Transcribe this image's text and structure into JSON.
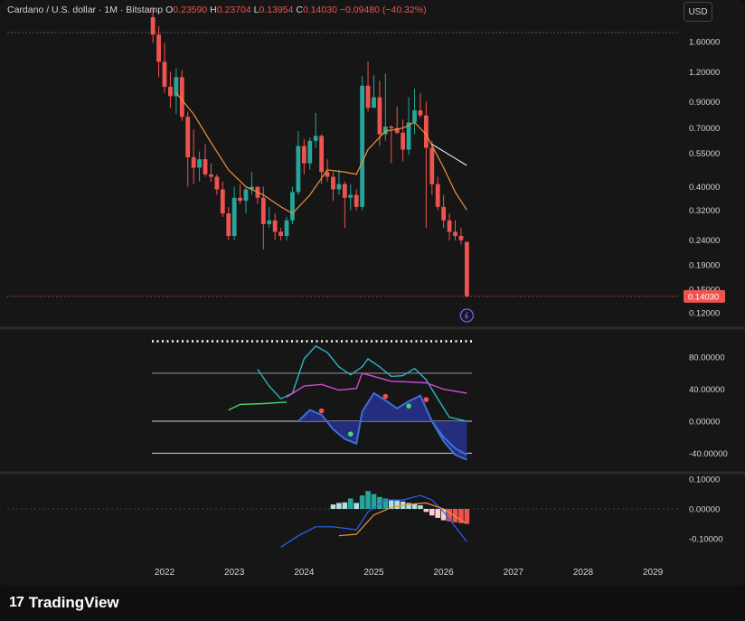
{
  "header": {
    "symbol": "Cardano / U.S. dollar · 1M · Bitstamp",
    "open_label": "O",
    "open": "0.23590",
    "high_label": "H",
    "high": "0.23704",
    "low_label": "L",
    "low": "0.13954",
    "close_label": "C",
    "close": "0.14030",
    "change": "−0.09480 (−40.32%)"
  },
  "currency": "USD",
  "brand": {
    "logo": "17",
    "name": "TradingView"
  },
  "colors": {
    "up": "#26a69a",
    "down": "#ef5350",
    "ma": "#f0923a",
    "ma_tail": "#ffffff",
    "accent": "#7b5cff"
  },
  "chart_data": [
    {
      "type": "candlestick",
      "y_scale": "log",
      "ylim": [
        0.11,
        1.9
      ],
      "yticks": [
        "1.60000",
        "1.20000",
        "0.90000",
        "0.70000",
        "0.55000",
        "0.40000",
        "0.32000",
        "0.24000",
        "0.19000",
        "0.15000",
        "0.12000"
      ],
      "last_price_label": "0.14030",
      "xticks": [
        "2022",
        "2023",
        "2024",
        "2025",
        "2026",
        "2027",
        "2028",
        "2029"
      ],
      "candles": [
        {
          "date": "2021-11",
          "o": 2.02,
          "h": 2.21,
          "l": 1.58,
          "c": 1.71
        },
        {
          "date": "2021-12",
          "o": 1.71,
          "h": 1.85,
          "l": 1.14,
          "c": 1.32
        },
        {
          "date": "2022-01",
          "o": 1.32,
          "h": 1.58,
          "l": 0.98,
          "c": 1.04
        },
        {
          "date": "2022-02",
          "o": 1.04,
          "h": 1.2,
          "l": 0.85,
          "c": 0.95
        },
        {
          "date": "2022-03",
          "o": 0.95,
          "h": 1.24,
          "l": 0.8,
          "c": 1.14
        },
        {
          "date": "2022-04",
          "o": 1.14,
          "h": 1.22,
          "l": 0.75,
          "c": 0.78
        },
        {
          "date": "2022-05",
          "o": 0.78,
          "h": 0.82,
          "l": 0.4,
          "c": 0.53
        },
        {
          "date": "2022-06",
          "o": 0.53,
          "h": 0.69,
          "l": 0.41,
          "c": 0.48
        },
        {
          "date": "2022-07",
          "o": 0.48,
          "h": 0.56,
          "l": 0.42,
          "c": 0.52
        },
        {
          "date": "2022-08",
          "o": 0.52,
          "h": 0.6,
          "l": 0.44,
          "c": 0.45
        },
        {
          "date": "2022-09",
          "o": 0.45,
          "h": 0.5,
          "l": 0.42,
          "c": 0.44
        },
        {
          "date": "2022-10",
          "o": 0.44,
          "h": 0.45,
          "l": 0.37,
          "c": 0.39
        },
        {
          "date": "2022-11",
          "o": 0.39,
          "h": 0.42,
          "l": 0.3,
          "c": 0.31
        },
        {
          "date": "2022-12",
          "o": 0.31,
          "h": 0.33,
          "l": 0.24,
          "c": 0.25
        },
        {
          "date": "2023-01",
          "o": 0.25,
          "h": 0.4,
          "l": 0.24,
          "c": 0.36
        },
        {
          "date": "2023-02",
          "o": 0.36,
          "h": 0.41,
          "l": 0.34,
          "c": 0.35
        },
        {
          "date": "2023-03",
          "o": 0.35,
          "h": 0.4,
          "l": 0.31,
          "c": 0.39
        },
        {
          "date": "2023-04",
          "o": 0.39,
          "h": 0.46,
          "l": 0.37,
          "c": 0.4
        },
        {
          "date": "2023-05",
          "o": 0.4,
          "h": 0.4,
          "l": 0.34,
          "c": 0.36
        },
        {
          "date": "2023-06",
          "o": 0.36,
          "h": 0.4,
          "l": 0.22,
          "c": 0.28
        },
        {
          "date": "2023-07",
          "o": 0.28,
          "h": 0.33,
          "l": 0.27,
          "c": 0.29
        },
        {
          "date": "2023-08",
          "o": 0.29,
          "h": 0.31,
          "l": 0.24,
          "c": 0.26
        },
        {
          "date": "2023-09",
          "o": 0.26,
          "h": 0.27,
          "l": 0.24,
          "c": 0.25
        },
        {
          "date": "2023-10",
          "o": 0.25,
          "h": 0.3,
          "l": 0.24,
          "c": 0.29
        },
        {
          "date": "2023-11",
          "o": 0.29,
          "h": 0.4,
          "l": 0.28,
          "c": 0.38
        },
        {
          "date": "2023-12",
          "o": 0.38,
          "h": 0.68,
          "l": 0.37,
          "c": 0.59
        },
        {
          "date": "2024-01",
          "o": 0.59,
          "h": 0.63,
          "l": 0.45,
          "c": 0.5
        },
        {
          "date": "2024-02",
          "o": 0.5,
          "h": 0.64,
          "l": 0.47,
          "c": 0.62
        },
        {
          "date": "2024-03",
          "o": 0.62,
          "h": 0.81,
          "l": 0.58,
          "c": 0.65
        },
        {
          "date": "2024-04",
          "o": 0.65,
          "h": 0.66,
          "l": 0.41,
          "c": 0.46
        },
        {
          "date": "2024-05",
          "o": 0.46,
          "h": 0.52,
          "l": 0.42,
          "c": 0.44
        },
        {
          "date": "2024-06",
          "o": 0.44,
          "h": 0.46,
          "l": 0.35,
          "c": 0.39
        },
        {
          "date": "2024-07",
          "o": 0.39,
          "h": 0.47,
          "l": 0.37,
          "c": 0.41
        },
        {
          "date": "2024-08",
          "o": 0.41,
          "h": 0.42,
          "l": 0.27,
          "c": 0.36
        },
        {
          "date": "2024-09",
          "o": 0.36,
          "h": 0.41,
          "l": 0.32,
          "c": 0.37
        },
        {
          "date": "2024-10",
          "o": 0.37,
          "h": 0.39,
          "l": 0.32,
          "c": 0.33
        },
        {
          "date": "2024-11",
          "o": 0.33,
          "h": 1.15,
          "l": 0.32,
          "c": 1.05
        },
        {
          "date": "2024-12",
          "o": 1.05,
          "h": 1.32,
          "l": 0.82,
          "c": 0.85
        },
        {
          "date": "2025-01",
          "o": 0.85,
          "h": 1.16,
          "l": 0.85,
          "c": 0.94
        },
        {
          "date": "2025-02",
          "o": 0.94,
          "h": 1.1,
          "l": 0.59,
          "c": 0.66
        },
        {
          "date": "2025-03",
          "o": 0.66,
          "h": 1.18,
          "l": 0.62,
          "c": 0.71
        },
        {
          "date": "2025-04",
          "o": 0.71,
          "h": 0.72,
          "l": 0.5,
          "c": 0.7
        },
        {
          "date": "2025-05",
          "o": 0.7,
          "h": 0.86,
          "l": 0.66,
          "c": 0.67
        },
        {
          "date": "2025-06",
          "o": 0.67,
          "h": 0.76,
          "l": 0.51,
          "c": 0.57
        },
        {
          "date": "2025-07",
          "o": 0.57,
          "h": 0.94,
          "l": 0.54,
          "c": 0.74
        },
        {
          "date": "2025-08",
          "o": 0.74,
          "h": 1.02,
          "l": 0.66,
          "c": 0.83
        },
        {
          "date": "2025-09",
          "o": 0.83,
          "h": 0.98,
          "l": 0.77,
          "c": 0.79
        },
        {
          "date": "2025-10",
          "o": 0.79,
          "h": 0.9,
          "l": 0.27,
          "c": 0.58
        },
        {
          "date": "2025-11",
          "o": 0.58,
          "h": 0.62,
          "l": 0.37,
          "c": 0.41
        },
        {
          "date": "2025-12",
          "o": 0.41,
          "h": 0.44,
          "l": 0.32,
          "c": 0.33
        },
        {
          "date": "2026-01",
          "o": 0.33,
          "h": 0.37,
          "l": 0.27,
          "c": 0.29
        },
        {
          "date": "2026-02",
          "o": 0.29,
          "h": 0.31,
          "l": 0.24,
          "c": 0.26
        },
        {
          "date": "2026-03",
          "o": 0.26,
          "h": 0.29,
          "l": 0.24,
          "c": 0.25
        },
        {
          "date": "2026-04",
          "o": 0.25,
          "h": 0.27,
          "l": 0.23,
          "c": 0.24
        },
        {
          "date": "2026-05",
          "o": 0.2359,
          "h": 0.23704,
          "l": 0.13954,
          "c": 0.1403
        }
      ],
      "moving_average": [
        {
          "date": "2022-03",
          "v": 0.98
        },
        {
          "date": "2022-06",
          "v": 0.8
        },
        {
          "date": "2022-09",
          "v": 0.61
        },
        {
          "date": "2022-12",
          "v": 0.47
        },
        {
          "date": "2023-03",
          "v": 0.4
        },
        {
          "date": "2023-06",
          "v": 0.37
        },
        {
          "date": "2023-09",
          "v": 0.33
        },
        {
          "date": "2023-11",
          "v": 0.31
        },
        {
          "date": "2024-02",
          "v": 0.37
        },
        {
          "date": "2024-05",
          "v": 0.47
        },
        {
          "date": "2024-08",
          "v": 0.46
        },
        {
          "date": "2024-10",
          "v": 0.45
        },
        {
          "date": "2024-12",
          "v": 0.57
        },
        {
          "date": "2025-03",
          "v": 0.68
        },
        {
          "date": "2025-06",
          "v": 0.7
        },
        {
          "date": "2025-08",
          "v": 0.74
        },
        {
          "date": "2025-10",
          "v": 0.66
        },
        {
          "date": "2026-01",
          "v": 0.48
        },
        {
          "date": "2026-03",
          "v": 0.38
        },
        {
          "date": "2026-05",
          "v": 0.32
        }
      ],
      "ma_extension": [
        {
          "date": "2025-11",
          "v": 0.6
        },
        {
          "date": "2026-05",
          "v": 0.49
        }
      ]
    },
    {
      "type": "line",
      "ylim": [
        -55,
        105
      ],
      "yticks": [
        "80.00000",
        "40.00000",
        "0.00000",
        "-40.00000"
      ],
      "levels": [
        100,
        60,
        0,
        -40
      ],
      "series": [
        {
          "role": "oscillator",
          "color": "#2bb5c0",
          "points": [
            {
              "date": "2023-05",
              "v": 65
            },
            {
              "date": "2023-07",
              "v": 44
            },
            {
              "date": "2023-09",
              "v": 28
            },
            {
              "date": "2023-11",
              "v": 35
            },
            {
              "date": "2024-01",
              "v": 78
            },
            {
              "date": "2024-03",
              "v": 94
            },
            {
              "date": "2024-05",
              "v": 86
            },
            {
              "date": "2024-07",
              "v": 68
            },
            {
              "date": "2024-09",
              "v": 58
            },
            {
              "date": "2024-11",
              "v": 68
            },
            {
              "date": "2024-12",
              "v": 78
            },
            {
              "date": "2025-02",
              "v": 68
            },
            {
              "date": "2025-04",
              "v": 56
            },
            {
              "date": "2025-06",
              "v": 57
            },
            {
              "date": "2025-08",
              "v": 66
            },
            {
              "date": "2025-10",
              "v": 52
            },
            {
              "date": "2025-12",
              "v": 28
            },
            {
              "date": "2026-02",
              "v": 5
            },
            {
              "date": "2026-05",
              "v": 0
            }
          ]
        },
        {
          "role": "signal",
          "color": "#d448d4",
          "points": [
            {
              "date": "2023-10",
              "v": 30
            },
            {
              "date": "2024-01",
              "v": 44
            },
            {
              "date": "2024-04",
              "v": 46
            },
            {
              "date": "2024-07",
              "v": 39
            },
            {
              "date": "2024-10",
              "v": 41
            },
            {
              "date": "2024-11",
              "v": 60
            },
            {
              "date": "2025-01",
              "v": 56
            },
            {
              "date": "2025-04",
              "v": 50
            },
            {
              "date": "2025-07",
              "v": 49
            },
            {
              "date": "2025-10",
              "v": 48
            },
            {
              "date": "2026-01",
              "v": 40
            },
            {
              "date": "2026-05",
              "v": 35
            }
          ]
        },
        {
          "role": "early",
          "color": "#48d86a",
          "points": [
            {
              "date": "2022-12",
              "v": 14
            },
            {
              "date": "2023-02",
              "v": 21
            },
            {
              "date": "2023-06",
              "v": 22
            },
            {
              "date": "2023-10",
              "v": 24
            }
          ]
        }
      ],
      "fill_band": [
        {
          "date": "2023-12",
          "v": 0
        },
        {
          "date": "2024-02",
          "v": 14
        },
        {
          "date": "2024-04",
          "v": 8
        },
        {
          "date": "2024-06",
          "v": -10
        },
        {
          "date": "2024-08",
          "v": -22
        },
        {
          "date": "2024-10",
          "v": -28
        },
        {
          "date": "2024-11",
          "v": 12
        },
        {
          "date": "2025-01",
          "v": 35
        },
        {
          "date": "2025-03",
          "v": 26
        },
        {
          "date": "2025-05",
          "v": 16
        },
        {
          "date": "2025-07",
          "v": 25
        },
        {
          "date": "2025-09",
          "v": 32
        },
        {
          "date": "2025-11",
          "v": 0
        },
        {
          "date": "2026-01",
          "v": -25
        },
        {
          "date": "2026-03",
          "v": -42
        },
        {
          "date": "2026-05",
          "v": -48
        }
      ],
      "band_lower": [
        {
          "date": "2025-11",
          "v": 0
        },
        {
          "date": "2026-01",
          "v": -20
        },
        {
          "date": "2026-03",
          "v": -34
        },
        {
          "date": "2026-05",
          "v": -42
        }
      ],
      "markers": [
        {
          "date": "2024-04",
          "v": 13,
          "color": "#ef5350"
        },
        {
          "date": "2024-09",
          "v": -16,
          "color": "#48d86a"
        },
        {
          "date": "2025-03",
          "v": 31,
          "color": "#ef5350"
        },
        {
          "date": "2025-07",
          "v": 19,
          "color": "#48d86a"
        },
        {
          "date": "2025-10",
          "v": 27,
          "color": "#ef5350"
        }
      ]
    },
    {
      "type": "bar",
      "ylim": [
        -0.13,
        0.14
      ],
      "yticks": [
        "0.10000",
        "0.00000",
        "-0.10000"
      ],
      "histogram": [
        {
          "date": "2024-06",
          "v": 0.015
        },
        {
          "date": "2024-07",
          "v": 0.02
        },
        {
          "date": "2024-08",
          "v": 0.022
        },
        {
          "date": "2024-09",
          "v": 0.035
        },
        {
          "date": "2024-10",
          "v": 0.02
        },
        {
          "date": "2024-11",
          "v": 0.045
        },
        {
          "date": "2024-12",
          "v": 0.06
        },
        {
          "date": "2025-01",
          "v": 0.05
        },
        {
          "date": "2025-02",
          "v": 0.04
        },
        {
          "date": "2025-03",
          "v": 0.035
        },
        {
          "date": "2025-04",
          "v": 0.03
        },
        {
          "date": "2025-05",
          "v": 0.028
        },
        {
          "date": "2025-06",
          "v": 0.025
        },
        {
          "date": "2025-07",
          "v": 0.02
        },
        {
          "date": "2025-08",
          "v": 0.018
        },
        {
          "date": "2025-09",
          "v": 0.012
        },
        {
          "date": "2025-10",
          "v": -0.01
        },
        {
          "date": "2025-11",
          "v": -0.022
        },
        {
          "date": "2025-12",
          "v": -0.03
        },
        {
          "date": "2026-01",
          "v": -0.038
        },
        {
          "date": "2026-02",
          "v": -0.042
        },
        {
          "date": "2026-03",
          "v": -0.045
        },
        {
          "date": "2026-04",
          "v": -0.048
        },
        {
          "date": "2026-05",
          "v": -0.05
        }
      ],
      "series": [
        {
          "role": "macd",
          "color": "#2962ff",
          "points": [
            {
              "date": "2023-09",
              "v": -0.128
            },
            {
              "date": "2023-12",
              "v": -0.09
            },
            {
              "date": "2024-03",
              "v": -0.06
            },
            {
              "date": "2024-06",
              "v": -0.06
            },
            {
              "date": "2024-10",
              "v": -0.07
            },
            {
              "date": "2024-12",
              "v": -0.01
            },
            {
              "date": "2025-03",
              "v": 0.03
            },
            {
              "date": "2025-06",
              "v": 0.03
            },
            {
              "date": "2025-09",
              "v": 0.045
            },
            {
              "date": "2025-11",
              "v": 0.03
            },
            {
              "date": "2026-01",
              "v": -0.01
            },
            {
              "date": "2026-03",
              "v": -0.06
            },
            {
              "date": "2026-05",
              "v": -0.11
            }
          ]
        },
        {
          "role": "signal",
          "color": "#f0923a",
          "points": [
            {
              "date": "2024-07",
              "v": -0.09
            },
            {
              "date": "2024-10",
              "v": -0.085
            },
            {
              "date": "2025-01",
              "v": -0.02
            },
            {
              "date": "2025-04",
              "v": 0.005
            },
            {
              "date": "2025-07",
              "v": 0.015
            },
            {
              "date": "2025-10",
              "v": 0.02
            },
            {
              "date": "2026-01",
              "v": 0.0
            },
            {
              "date": "2026-03",
              "v": -0.025
            },
            {
              "date": "2026-05",
              "v": -0.05
            }
          ]
        }
      ]
    }
  ]
}
